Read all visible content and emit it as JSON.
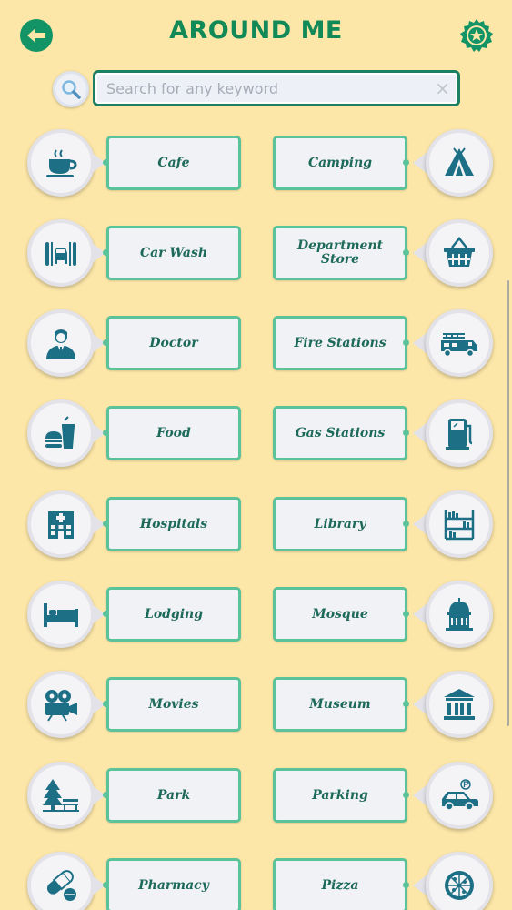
{
  "header": {
    "title": "AROUND ME",
    "back_icon": "arrow-left-icon",
    "favorite_icon": "star-badge-icon"
  },
  "search": {
    "placeholder": "Search for any keyword",
    "value": "",
    "clear_label": "×"
  },
  "colors": {
    "background": "#fde7a8",
    "accent": "#128a58",
    "icon": "#1d6f86",
    "label_border": "#5ac39a"
  },
  "categories": [
    {
      "label": "Cafe",
      "icon": "coffee-cup-icon"
    },
    {
      "label": "Camping",
      "icon": "tent-icon"
    },
    {
      "label": "Car Wash",
      "icon": "car-wash-icon"
    },
    {
      "label": "Department Store",
      "icon": "shopping-basket-icon"
    },
    {
      "label": "Doctor",
      "icon": "doctor-icon"
    },
    {
      "label": "Fire Stations",
      "icon": "fire-truck-icon"
    },
    {
      "label": "Food",
      "icon": "burger-drink-icon"
    },
    {
      "label": "Gas Stations",
      "icon": "fuel-pump-icon"
    },
    {
      "label": "Hospitals",
      "icon": "hospital-building-icon"
    },
    {
      "label": "Library",
      "icon": "bookshelf-icon"
    },
    {
      "label": "Lodging",
      "icon": "bed-icon"
    },
    {
      "label": "Mosque",
      "icon": "mosque-icon"
    },
    {
      "label": "Movies",
      "icon": "film-camera-icon"
    },
    {
      "label": "Museum",
      "icon": "museum-icon"
    },
    {
      "label": "Park",
      "icon": "tree-bench-icon"
    },
    {
      "label": "Parking",
      "icon": "parked-car-icon"
    },
    {
      "label": "Pharmacy",
      "icon": "pill-capsule-icon"
    },
    {
      "label": "Pizza",
      "icon": "pizza-icon"
    }
  ]
}
